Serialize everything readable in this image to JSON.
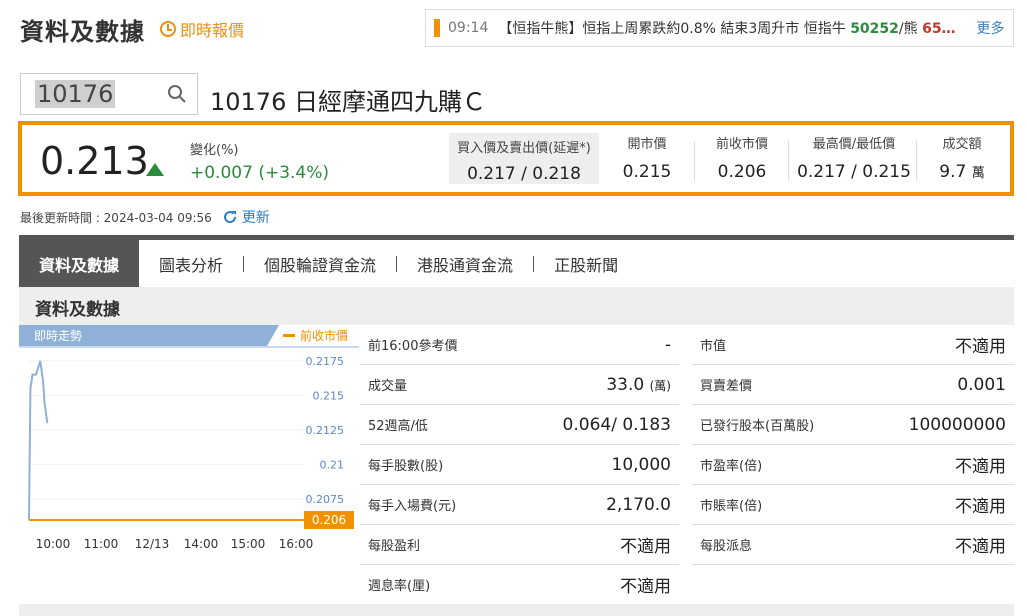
{
  "header": {
    "title": "資料及數據",
    "realtime_label": "即時報價"
  },
  "ticker": {
    "time": "09:14",
    "text": "【恒指牛熊】恒指上周累跌約0.8% 結束3周升市 恒指牛",
    "num_bull": "50252",
    "slash": "/熊",
    "num_bear": "65…",
    "more": "更多"
  },
  "search": {
    "value": "10176"
  },
  "stock": {
    "name": "10176 日經摩通四九購Ｃ"
  },
  "quote": {
    "price": "0.213",
    "change_label": "變化(%)",
    "change": "+0.007 (+3.4%)",
    "bidask_label": "買入價及賣出價(延遲*)",
    "bidask": "0.217 / 0.218",
    "open_label": "開市價",
    "open": "0.215",
    "prev_label": "前收市價",
    "prev": "0.206",
    "hl_label": "最高價/最低價",
    "hl": "0.217 / 0.215",
    "turnover_label": "成交額",
    "turnover": "9.7",
    "turnover_unit": "萬"
  },
  "updated": {
    "label": "最後更新時間 : 2024-03-04 09:56",
    "refresh": "更新"
  },
  "tabs": [
    "資料及數據",
    "圖表分析",
    "個股輪證資金流",
    "港股通資金流",
    "正股新聞"
  ],
  "section_title": "資料及數據",
  "chart_data": {
    "type": "line",
    "title": "即時走勢",
    "legend": "前收市價",
    "prev_close": 0.206,
    "prev_close_label": "0.206",
    "yticks": [
      "0.2175",
      "0.215",
      "0.2125",
      "0.21",
      "0.2075"
    ],
    "ytick_values": [
      0.2175,
      0.215,
      0.2125,
      0.21,
      0.2075
    ],
    "ylim": [
      0.206,
      0.2185
    ],
    "xticks": [
      "10:00",
      "11:00",
      "12/13",
      "14:00",
      "15:00",
      "16:00"
    ],
    "series": [
      {
        "x": [
          "09:30",
          "09:32",
          "09:35",
          "09:40",
          "09:43",
          "09:46",
          "09:50",
          "09:52",
          "09:56"
        ],
        "values": [
          0.206,
          0.2155,
          0.2165,
          0.2165,
          0.217,
          0.2175,
          0.216,
          0.2145,
          0.213
        ]
      }
    ],
    "colors": {
      "line": "#8fb1d8",
      "prev": "#f29100"
    }
  },
  "table_left": [
    {
      "k": "前16:00參考價",
      "v": "-"
    },
    {
      "k": "成交量",
      "v": "33.0",
      "u": "(萬)"
    },
    {
      "k": "52週高/低",
      "v": "0.064/ 0.183"
    },
    {
      "k": "每手股數(股)",
      "v": "10,000"
    },
    {
      "k": "每手入場費(元)",
      "v": "2,170.0"
    },
    {
      "k": "每股盈利",
      "v": "不適用"
    },
    {
      "k": "週息率(厘)",
      "v": "不適用"
    }
  ],
  "table_right": [
    {
      "k": "市值",
      "v": "不適用"
    },
    {
      "k": "買賣差價",
      "v": "0.001"
    },
    {
      "k": "已發行股本(百萬股)",
      "v": "100000000"
    },
    {
      "k": "市盈率(倍)",
      "v": "不適用"
    },
    {
      "k": "市賬率(倍)",
      "v": "不適用"
    },
    {
      "k": "每股派息",
      "v": "不適用"
    }
  ],
  "colors": {
    "accent": "#f29100",
    "up": "#2c8a3e",
    "link": "#3a7fc1"
  }
}
